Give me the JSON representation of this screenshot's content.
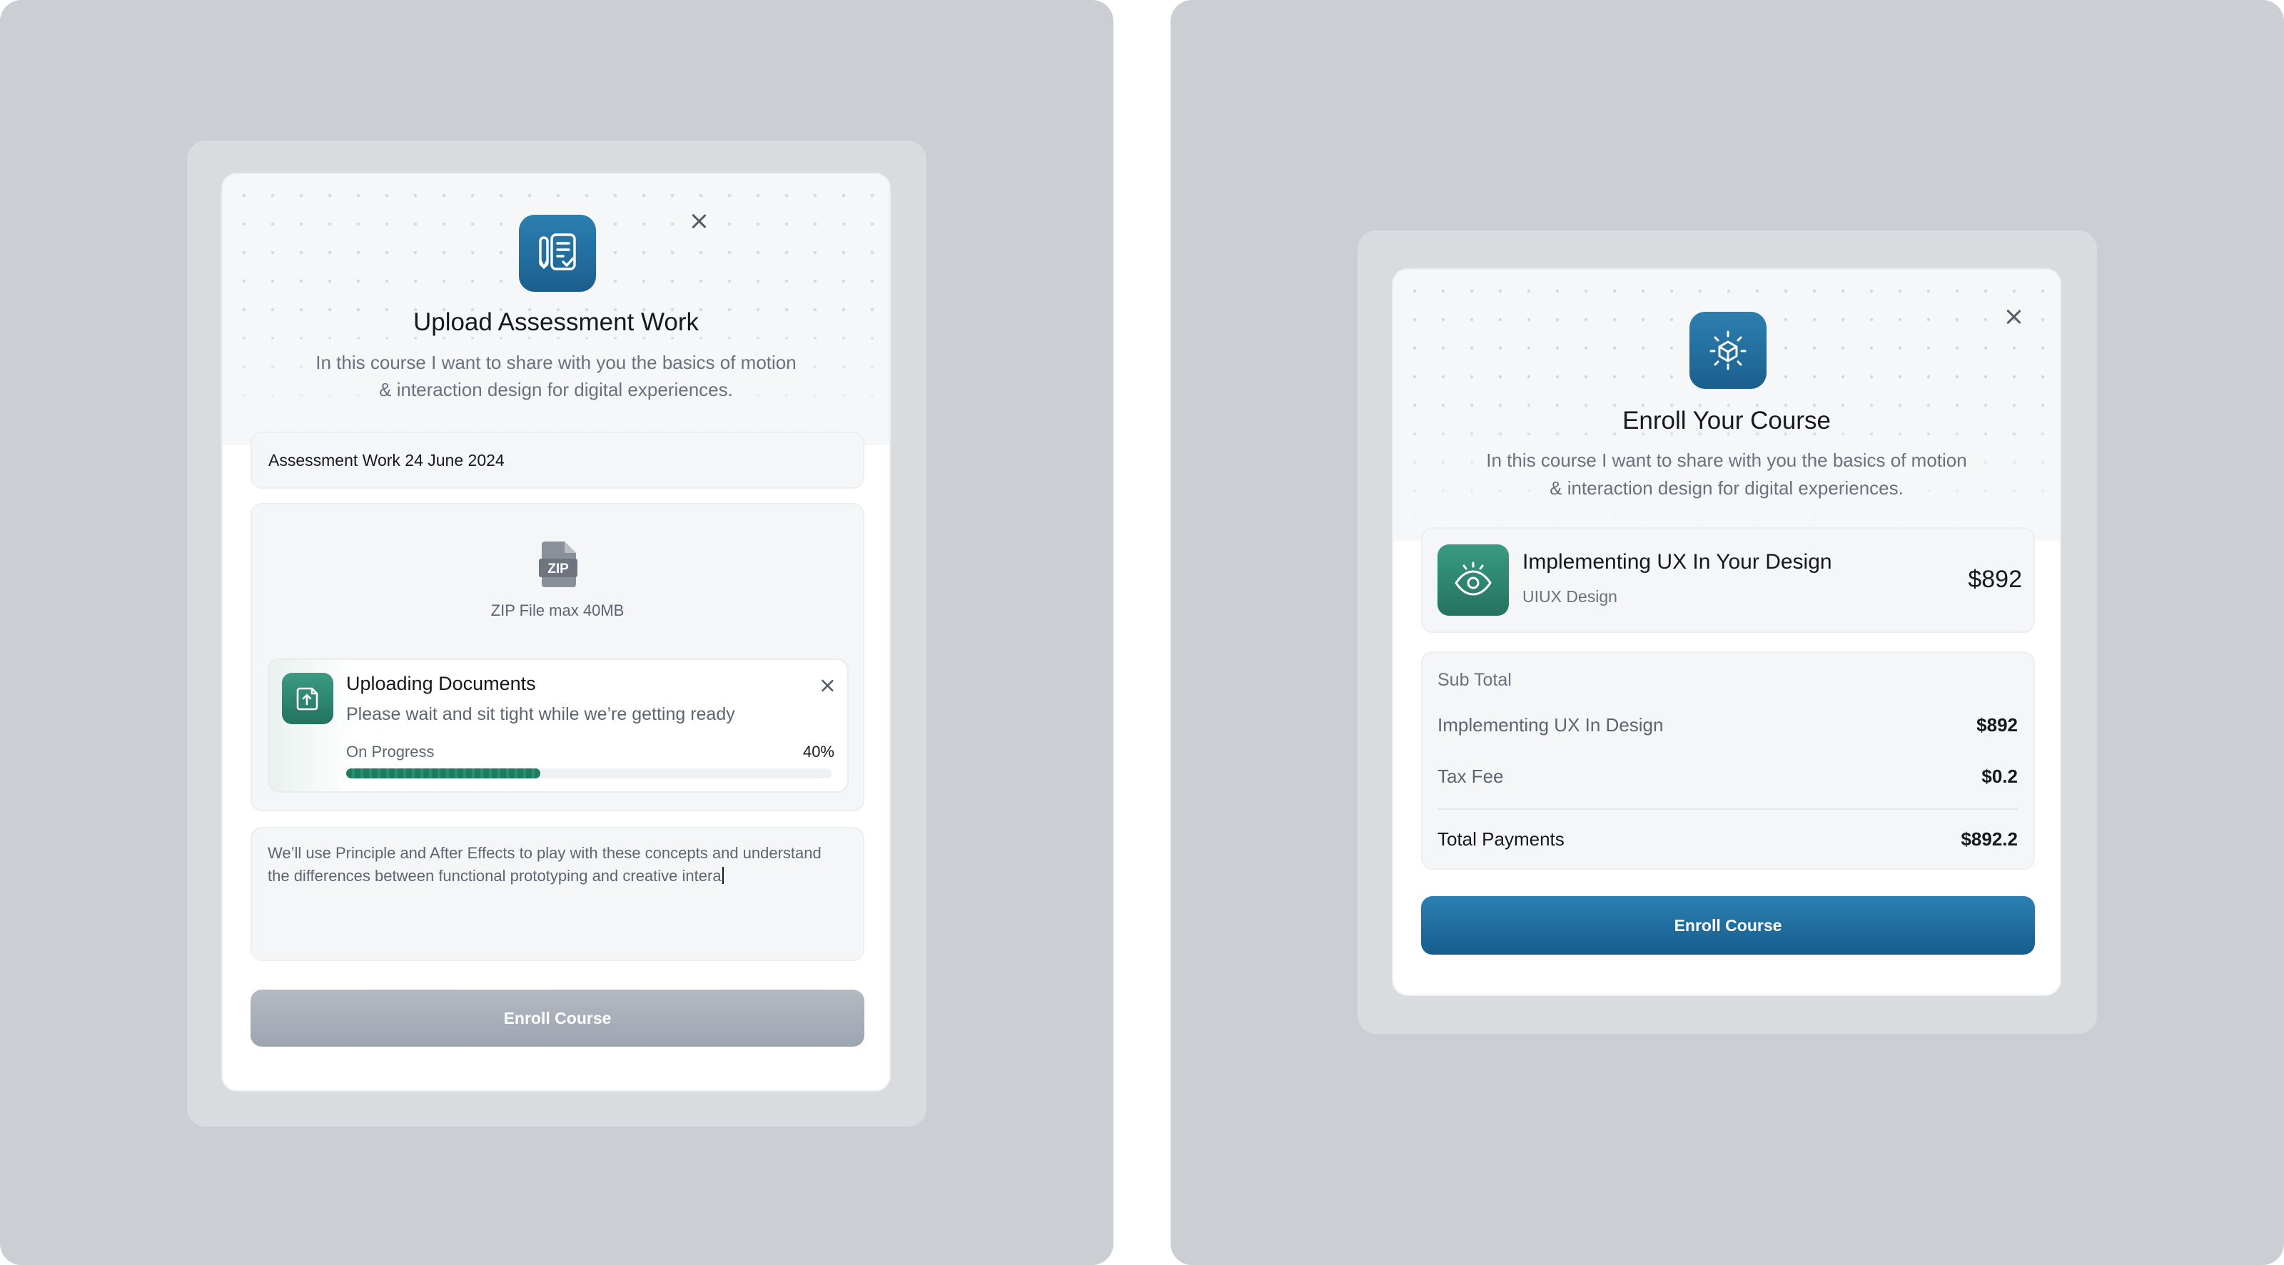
{
  "upload_modal": {
    "title": "Upload Assessment Work",
    "description_line1": "In this course I want to share with you the basics of motion",
    "description_line2": "& interaction design for digital experiences.",
    "name_field_value": "Assessment Work 24 June 2024",
    "dropzone": {
      "file_badge": "ZIP",
      "hint": "ZIP File max 40MB"
    },
    "upload_progress": {
      "title": "Uploading Documents",
      "message": "Please wait and sit tight while we’re getting ready",
      "status": "On Progress",
      "percent_label": "40%",
      "progress": 0.4
    },
    "notes_line1": "We’ll use Principle and After Effects to play with these concepts and understand",
    "notes_line2": "the differences between functional prototyping and creative intera",
    "submit_label": "Enroll Course"
  },
  "enroll_modal": {
    "title": "Enroll Your Course",
    "description_line1": "In this course I want to share with you the basics of motion",
    "description_line2": "& interaction design for digital experiences.",
    "course": {
      "name": "Implementing UX In Your Design",
      "category": "UIUX Design",
      "price": "$892"
    },
    "summary": {
      "heading": "Sub Total",
      "rows": [
        {
          "label": "Implementing UX In Design",
          "value": "$892"
        },
        {
          "label": "Tax Fee",
          "value": "$0.2"
        }
      ],
      "total_label": "Total Payments",
      "total_value": "$892.2"
    },
    "submit_label": "Enroll Course"
  },
  "colors": {
    "panel_bg": "#cbced2",
    "brand_blue": "#1d6a9b",
    "brand_green": "#2f8a74",
    "progress_green": "#1e7b61",
    "disabled_button": "#a3a9b4"
  },
  "icons": {
    "upload_modal_icon": "document-edit-icon",
    "enroll_modal_icon": "cube-sparkle-icon",
    "course_icon": "eye-icon",
    "upload_item_icon": "file-upload-icon",
    "dropzone_icon": "zip-file-icon",
    "close": "close-icon"
  }
}
